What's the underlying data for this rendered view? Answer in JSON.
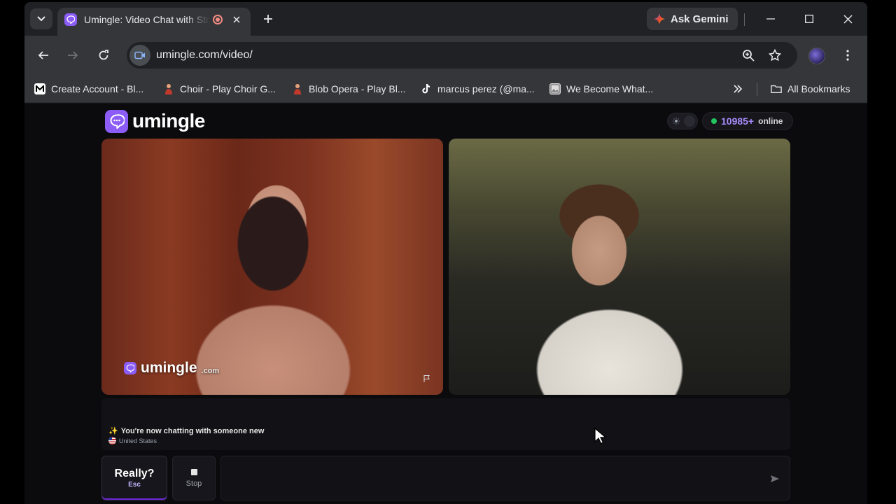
{
  "browser": {
    "tab": {
      "title": "Umingle: Video Chat with Strangers"
    },
    "ask_gemini_label": "Ask Gemini",
    "url": "umingle.com/video/",
    "bookmarks": [
      {
        "label": "Create Account - Bl...",
        "icon": "site-icon-m"
      },
      {
        "label": "Choir - Play Choir G...",
        "icon": "game-icon"
      },
      {
        "label": "Blob Opera - Play Bl...",
        "icon": "game-icon"
      },
      {
        "label": "marcus perez (@ma...",
        "icon": "tiktok-icon"
      },
      {
        "label": "We Become What...",
        "icon": "image-icon"
      }
    ],
    "all_bookmarks_label": "All Bookmarks"
  },
  "page": {
    "logo_text": "umingle",
    "online": {
      "count": "10985+",
      "label": "online"
    },
    "watermark": {
      "brand": "umingle",
      "suffix": ".com"
    },
    "chat": {
      "message": "You're now chatting with someone new",
      "country": "United States"
    },
    "controls": {
      "really_label": "Really?",
      "really_shortcut": "Esc",
      "stop_label": "Stop",
      "message_placeholder": ""
    }
  },
  "colors": {
    "accent": "#8b5cf6",
    "online_dot": "#22c55e",
    "online_count": "#a78bfa"
  }
}
